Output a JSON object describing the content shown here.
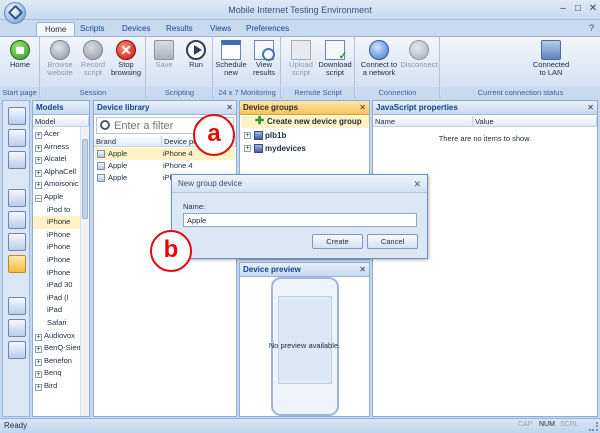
{
  "window": {
    "title": "Mobile Internet Testing Environment",
    "minimize": "–",
    "maximize": "□",
    "close": "✕"
  },
  "tabs": [
    "Home",
    "Scripts",
    "Devices",
    "Results",
    "Views",
    "Preferences"
  ],
  "help": "?",
  "ribbon": {
    "groups": [
      {
        "label": "Start page",
        "buttons": [
          {
            "label": "Home",
            "icon": "home-icon"
          }
        ]
      },
      {
        "label": "Session",
        "buttons": [
          {
            "label": "Browse website",
            "icon": "globe-icon"
          },
          {
            "label": "Record script",
            "icon": "record-icon"
          },
          {
            "label": "Stop browsing",
            "icon": "stop-icon",
            "glyph": "✕"
          }
        ]
      },
      {
        "label": "Scripting",
        "buttons": [
          {
            "label": "Save",
            "icon": "save-icon"
          },
          {
            "label": "Run",
            "icon": "run-icon"
          }
        ]
      },
      {
        "label": "24 x 7 Monitoring",
        "buttons": [
          {
            "label": "Schedule new",
            "icon": "calendar-icon"
          },
          {
            "label": "View results",
            "icon": "view-results-icon"
          }
        ]
      },
      {
        "label": "Remote Script Library",
        "buttons": [
          {
            "label": "Upload script",
            "icon": "upload-icon"
          },
          {
            "label": "Download script",
            "icon": "download-icon"
          }
        ]
      },
      {
        "label": "Connection",
        "buttons": [
          {
            "label": "Connect to a network",
            "icon": "network-icon"
          },
          {
            "label": "Disconnect",
            "icon": "disconnect-icon"
          }
        ]
      },
      {
        "label": "Current connection status",
        "buttons": [
          {
            "label": "Connected to LAN",
            "icon": "lan-icon"
          }
        ]
      }
    ]
  },
  "models": {
    "title": "Models",
    "column": "Model",
    "items": [
      {
        "label": "Acer",
        "expander": "+",
        "child": false
      },
      {
        "label": "Airness",
        "expander": "+",
        "child": false
      },
      {
        "label": "Alcatel",
        "expander": "+",
        "child": false
      },
      {
        "label": "AlphaCell",
        "expander": "+",
        "child": false
      },
      {
        "label": "Amoisonic",
        "expander": "+",
        "child": false
      },
      {
        "label": "Apple",
        "expander": "–",
        "child": false
      },
      {
        "label": "iPod to",
        "expander": "",
        "child": true
      },
      {
        "label": "iPhone",
        "expander": "",
        "child": true
      },
      {
        "label": "iPhone",
        "expander": "",
        "child": true
      },
      {
        "label": "iPhone",
        "expander": "",
        "child": true
      },
      {
        "label": "iPhone",
        "expander": "",
        "child": true
      },
      {
        "label": "iPhone",
        "expander": "",
        "child": true
      },
      {
        "label": "iPad 30",
        "expander": "",
        "child": true
      },
      {
        "label": "iPad (l",
        "expander": "",
        "child": true
      },
      {
        "label": "iPad",
        "expander": "",
        "child": true
      },
      {
        "label": "Safari",
        "expander": "",
        "child": true
      },
      {
        "label": "Audiovox",
        "expander": "+",
        "child": false
      },
      {
        "label": "BenQ-Siem",
        "expander": "+",
        "child": false
      },
      {
        "label": "Benefon",
        "expander": "+",
        "child": false
      },
      {
        "label": "Benq",
        "expander": "+",
        "child": false
      },
      {
        "label": "Bird",
        "expander": "+",
        "child": false
      }
    ]
  },
  "library": {
    "title": "Device library",
    "filter_placeholder": "Enter a filter",
    "columns": [
      "Brand",
      "Device profile"
    ],
    "rows": [
      {
        "brand": "Apple",
        "device": "iPhone 4"
      },
      {
        "brand": "Apple",
        "device": "iPhone 4"
      },
      {
        "brand": "Apple",
        "device": "iPhone 4"
      }
    ]
  },
  "groups": {
    "title": "Device groups",
    "create": "Create new device group",
    "items": [
      {
        "label": "plb1b",
        "expander": "+"
      },
      {
        "label": "mydevices",
        "expander": "+"
      }
    ]
  },
  "preview": {
    "title": "Device preview",
    "empty": "No preview available."
  },
  "js": {
    "title": "JavaScript properties",
    "columns": [
      "Name",
      "Value"
    ],
    "empty": "There are no items to show."
  },
  "dialog": {
    "title": "New group device",
    "name_label": "Name:",
    "name_value": "Apple",
    "create": "Create",
    "cancel": "Cancel",
    "close": "✕"
  },
  "callouts": [
    "a",
    "b"
  ],
  "status": {
    "text": "Ready",
    "indicators": [
      "CAP",
      "NUM",
      "SCRL"
    ]
  },
  "panel_close": "✕"
}
